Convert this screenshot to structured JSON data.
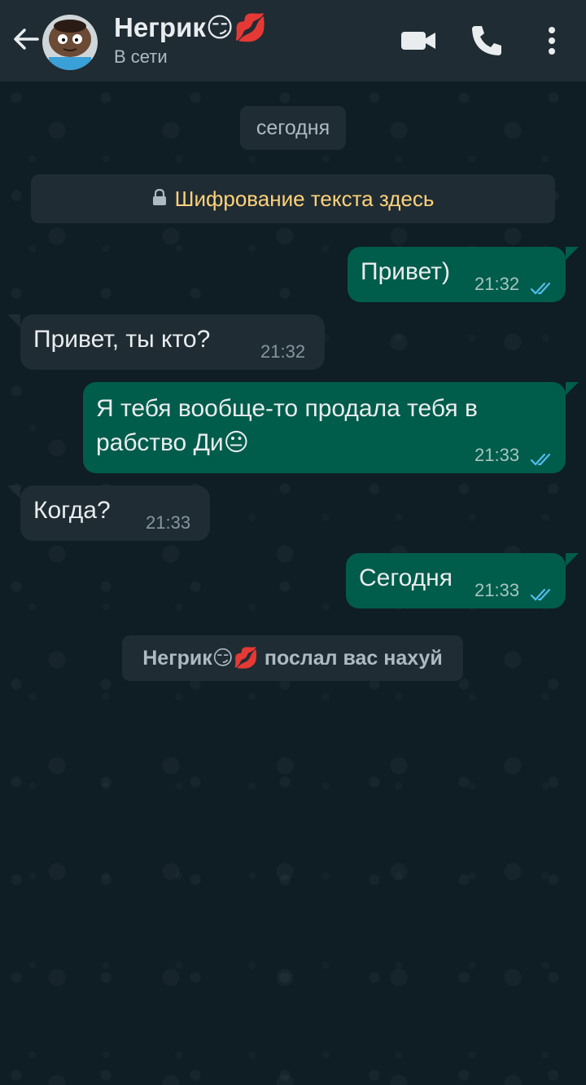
{
  "header": {
    "contact_name": "Негрик😏💋",
    "status": "В сети"
  },
  "chat": {
    "date_chip": "сегодня",
    "encryption_notice": "Шифрование текста здесь",
    "messages": [
      {
        "direction": "out",
        "text": "Привет)",
        "time": "21:32",
        "read": true
      },
      {
        "direction": "in",
        "text": "Привет, ты кто?",
        "time": "21:32"
      },
      {
        "direction": "out",
        "text": "Я тебя вообще-то продала тебя в рабство Ди😐",
        "time": "21:33",
        "read": true
      },
      {
        "direction": "in",
        "text": "Когда?",
        "time": "21:33"
      },
      {
        "direction": "out",
        "text": "Сегодня",
        "time": "21:33",
        "read": true
      }
    ],
    "system_message": "Негрик😏💋 послал вас нахуй"
  },
  "colors": {
    "header_bg": "#1f2c34",
    "outgoing_bubble": "#005c4b",
    "incoming_bubble": "#1f2c34",
    "read_ticks": "#53bdeb",
    "encryption_text": "#ffd279"
  }
}
